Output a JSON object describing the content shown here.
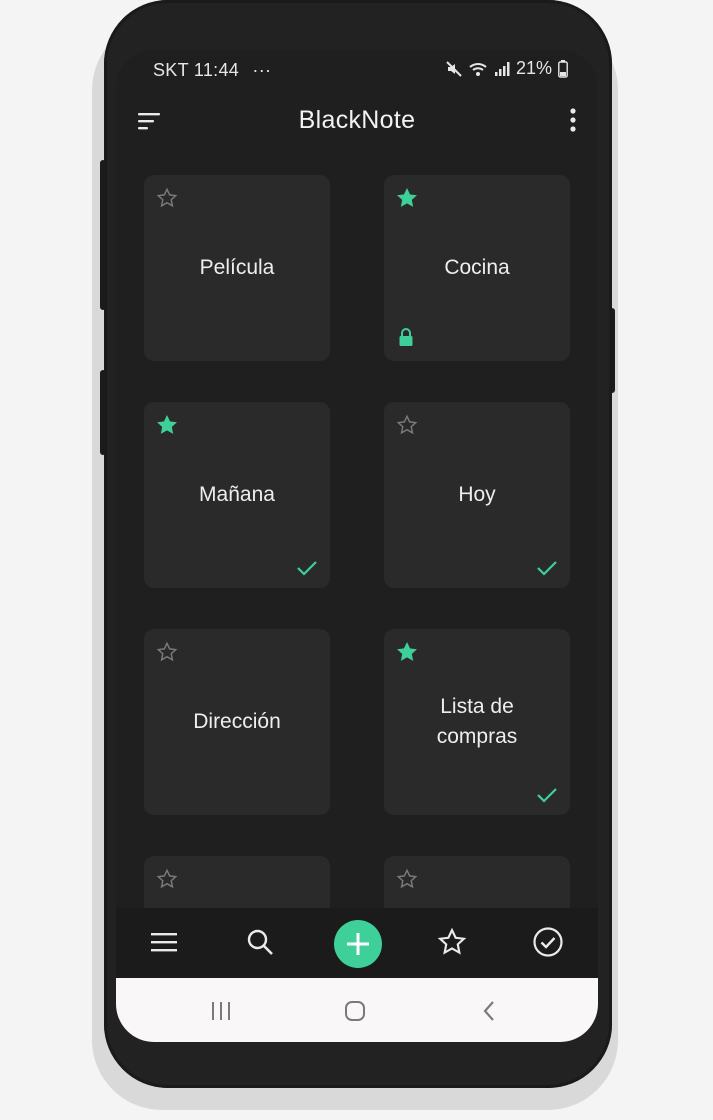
{
  "status_bar": {
    "carrier_time": "SKT 11:44",
    "more": "···",
    "battery": "21%"
  },
  "app_bar": {
    "title": "BlackNote"
  },
  "notes": [
    {
      "title": "Película",
      "starred": false,
      "locked": false,
      "checked": false
    },
    {
      "title": "Cocina",
      "starred": true,
      "locked": true,
      "checked": false
    },
    {
      "title": "Mañana",
      "starred": true,
      "locked": false,
      "checked": true
    },
    {
      "title": "Hoy",
      "starred": false,
      "locked": false,
      "checked": true
    },
    {
      "title": "Dirección",
      "starred": false,
      "locked": false,
      "checked": false
    },
    {
      "title": "Lista de compras",
      "starred": true,
      "locked": false,
      "checked": true
    },
    {
      "title": "",
      "starred": false,
      "locked": false,
      "checked": false
    },
    {
      "title": "",
      "starred": false,
      "locked": false,
      "checked": false
    }
  ],
  "bottom_nav": {
    "items": [
      "menu-icon",
      "search-icon",
      "add-icon",
      "star-icon",
      "check-circle-icon"
    ]
  },
  "colors": {
    "accent": "#3fcf98",
    "background": "#1f1f1f",
    "card": "#2a2a2a",
    "text": "#eeeeee"
  }
}
